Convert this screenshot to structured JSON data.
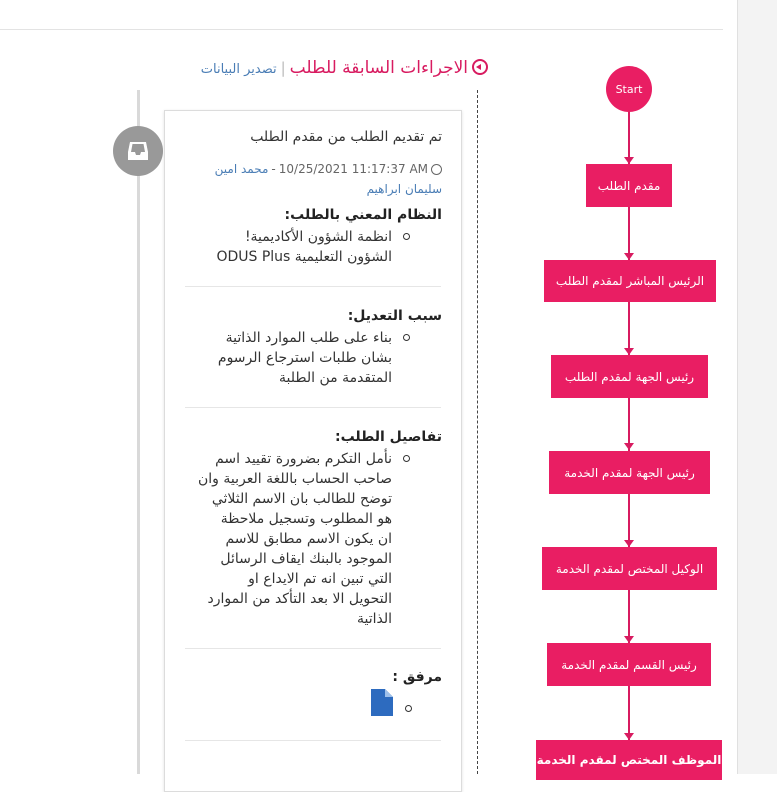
{
  "header": {
    "title": "الاجراءات السابقة للطلب",
    "separator": "|",
    "export_label": "تصدير البيانات"
  },
  "card": {
    "title": "تم تقديم الطلب من مقدم الطلب",
    "datetime": "10/25/2021 11:17:37 AM",
    "dash": "-",
    "user": "محمد امين سليمان ابراهيم",
    "sections": [
      {
        "title": "النظام المعني بالطلب:",
        "lines": [
          "انظمة الشؤون الأكاديمية!",
          "الشؤون التعليمية ODUS Plus"
        ]
      },
      {
        "title": "سبب التعديل:",
        "lines": [
          "بناء على طلب الموارد الذاتية",
          "بشان طلبات استرجاع الرسوم",
          "المتقدمة من الطلبة"
        ]
      },
      {
        "title": "تفاصيل الطلب:",
        "lines": [
          "نأمل التكرم بضرورة تقييد اسم",
          "صاحب الحساب باللغة العربية وان",
          "توضح للطالب بان الاسم الثلاثي",
          "هو المطلوب وتسجيل ملاحظة",
          "ان يكون الاسم مطابق للاسم",
          "الموجود بالبنك ايقاف الرسائل",
          "التي تبين انه تم الايداع او",
          "التحويل الا بعد التأكد من الموارد",
          "الذاتية"
        ]
      },
      {
        "title": "مرفق :",
        "lines": []
      }
    ]
  },
  "flowchart": {
    "start_label": "Start",
    "nodes": [
      "مقدم الطلب",
      "الرئيس المباشر لمقدم الطلب",
      "رئيس الجهة لمقدم الطلب",
      "رئيس الجهة لمقدم الخدمة",
      "الوكيل المختص لمقدم الخدمة",
      "رئيس القسم لمقدم الخدمة",
      "الموظف المختص لمقدم الخدمة"
    ]
  },
  "colors": {
    "accent": "#e91e63",
    "link": "#4a7db5",
    "timeline_icon": "#999999"
  },
  "icons": [
    "title-circle-arrow-icon",
    "clock-icon",
    "inbox-icon",
    "file-icon"
  ]
}
